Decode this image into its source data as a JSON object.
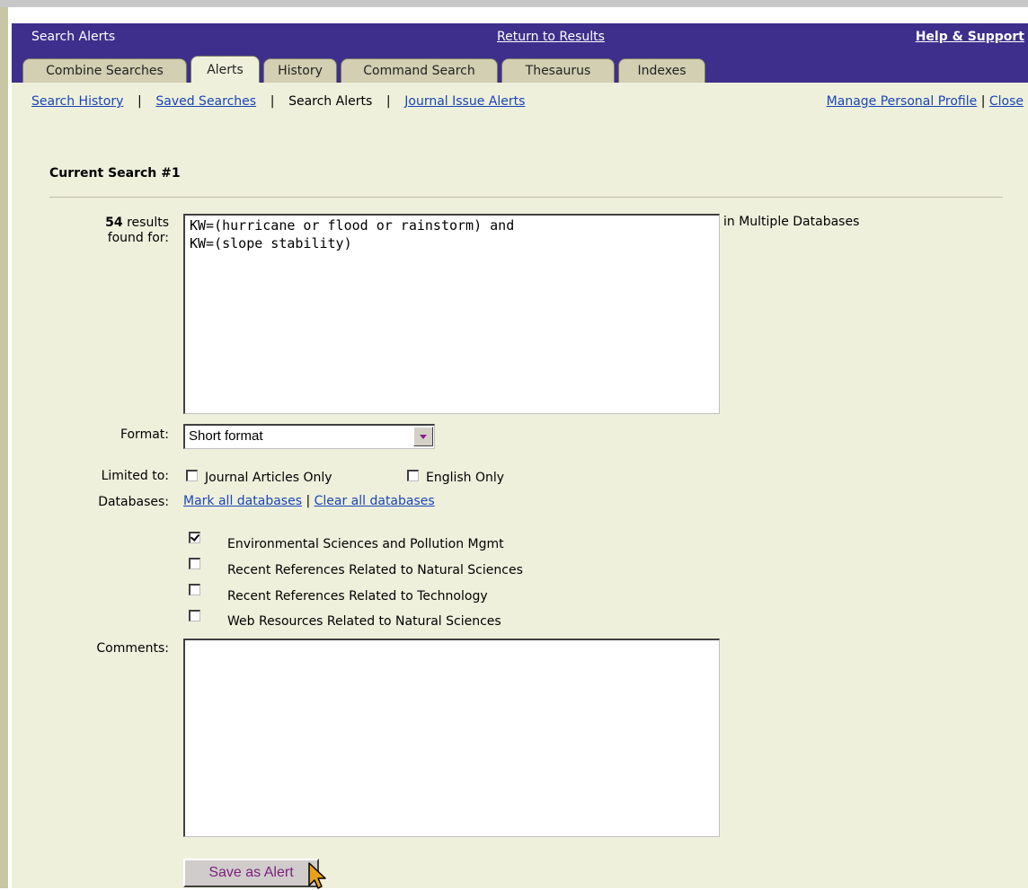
{
  "title_bar": {
    "title": "Search Alerts",
    "return_link": "Return to Results",
    "help_link": "Help & Support"
  },
  "tabs": [
    {
      "label": "Combine Searches",
      "active": false
    },
    {
      "label": "Alerts",
      "active": true
    },
    {
      "label": "History",
      "active": false
    },
    {
      "label": "Command Search",
      "active": false
    },
    {
      "label": "Thesaurus",
      "active": false
    },
    {
      "label": "Indexes",
      "active": false
    }
  ],
  "subnav": {
    "search_history": "Search History",
    "sep": "|",
    "saved_searches": "Saved Searches",
    "search_alerts": "Search Alerts",
    "journal_issue_alerts": "Journal Issue Alerts",
    "manage_profile": "Manage Personal Profile",
    "close": "Close"
  },
  "section": {
    "heading": "Current Search #1"
  },
  "results": {
    "count": "54",
    "suffix": " results",
    "found_for": "found for:",
    "query": "KW=(hurricane or flood or rainstorm) and\nKW=(slope stability)",
    "in_databases": "in Multiple Databases"
  },
  "format": {
    "label": "Format:",
    "selected": "Short format"
  },
  "limits": {
    "label": "Limited to:",
    "journal_articles": {
      "label": "Journal Articles Only",
      "checked": false
    },
    "english_only": {
      "label": "English Only",
      "checked": false
    }
  },
  "databases": {
    "label": "Databases:",
    "mark_all": "Mark all databases",
    "sep": "|",
    "clear_all": "Clear all databases",
    "items": [
      {
        "label": "Environmental Sciences and Pollution Mgmt",
        "checked": true
      },
      {
        "label": "Recent References Related to Natural Sciences",
        "checked": false
      },
      {
        "label": "Recent References Related to Technology",
        "checked": false
      },
      {
        "label": "Web Resources Related to Natural Sciences",
        "checked": false
      }
    ]
  },
  "comments": {
    "label": "Comments:",
    "value": ""
  },
  "save_button": "Save as Alert",
  "colors": {
    "header": "#3d2f8b",
    "content_bg": "#eef0dc",
    "link": "#1a45b5",
    "button_text": "#7b1f7b"
  },
  "icons": {
    "dropdown": "chevron-down-icon",
    "cursor": "mouse-pointer-icon"
  }
}
